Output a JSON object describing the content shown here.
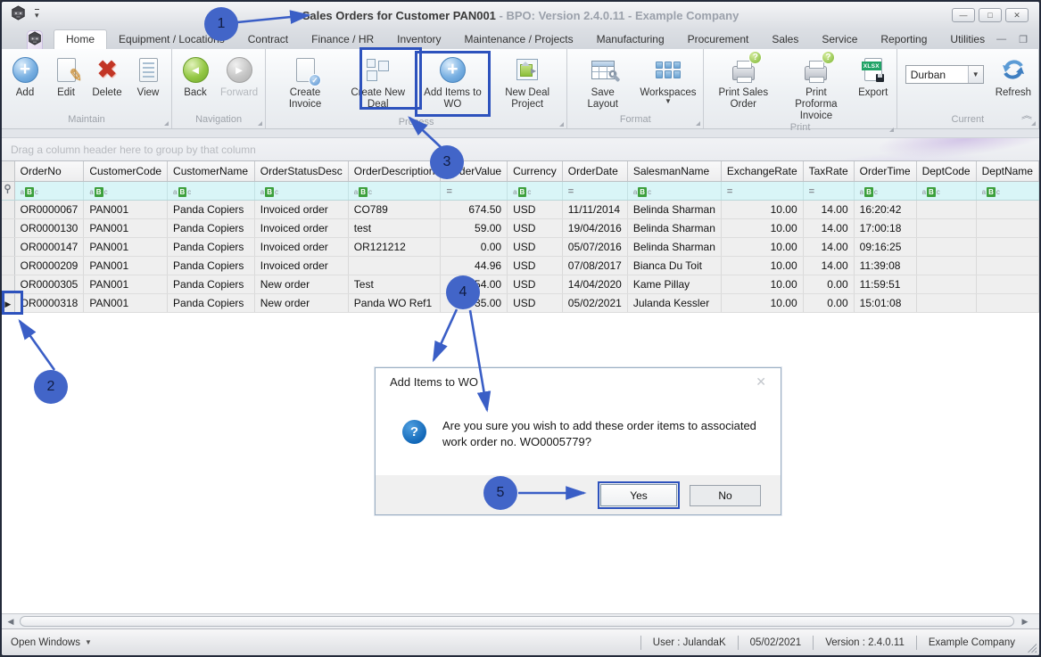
{
  "window": {
    "title_primary": "Sales Orders for Customer PAN001",
    "title_secondary": " - BPO: Version 2.4.0.11 - Example Company"
  },
  "tabs": [
    {
      "label": "Home",
      "active": true
    },
    {
      "label": "Equipment / Locations"
    },
    {
      "label": "Contract"
    },
    {
      "label": "Finance / HR"
    },
    {
      "label": "Inventory"
    },
    {
      "label": "Maintenance / Projects"
    },
    {
      "label": "Manufacturing"
    },
    {
      "label": "Procurement"
    },
    {
      "label": "Sales"
    },
    {
      "label": "Service"
    },
    {
      "label": "Reporting"
    },
    {
      "label": "Utilities"
    }
  ],
  "ribbon": {
    "groups": [
      {
        "label": "Maintain",
        "buttons": [
          {
            "label": "Add",
            "icon": "add-circle"
          },
          {
            "label": "Edit",
            "icon": "edit-pencil"
          },
          {
            "label": "Delete",
            "icon": "delete-x"
          },
          {
            "label": "View",
            "icon": "view-doc"
          }
        ]
      },
      {
        "label": "Navigation",
        "buttons": [
          {
            "label": "Back",
            "icon": "back-circle"
          },
          {
            "label": "Forward",
            "icon": "forward-circle",
            "disabled": true
          }
        ]
      },
      {
        "label": "Process",
        "buttons": [
          {
            "label": "Create Invoice",
            "icon": "invoice-doc"
          },
          {
            "label": "Create New Deal",
            "icon": "new-deal-squares"
          },
          {
            "label": "Add Items to WO",
            "icon": "add-circle",
            "highlighted": true
          },
          {
            "label": "New Deal Project",
            "icon": "deal-project"
          }
        ]
      },
      {
        "label": "Format",
        "buttons": [
          {
            "label": "Save Layout",
            "icon": "save-layout"
          },
          {
            "label": "Workspaces",
            "icon": "workspaces-grid",
            "dropdown": true
          }
        ]
      },
      {
        "label": "Print",
        "buttons": [
          {
            "label": "Print Sales Order",
            "icon": "printer-question"
          },
          {
            "label": "Print Proforma Invoice",
            "icon": "printer-question"
          },
          {
            "label": "Export",
            "icon": "export-xlsx"
          }
        ]
      },
      {
        "label": "Current",
        "buttons": [
          {
            "type": "combo",
            "value": "Durban"
          },
          {
            "label": "Refresh",
            "icon": "refresh-arrows"
          }
        ]
      }
    ]
  },
  "grid": {
    "group_by_hint": "Drag a column header here to group by that column",
    "filter_glyphs": {
      "text_a": "a",
      "text_b": "B",
      "text_c": "c",
      "numeric": "="
    },
    "columns": [
      {
        "label": "OrderNo",
        "filter": "abc"
      },
      {
        "label": "CustomerCode",
        "filter": "abc"
      },
      {
        "label": "CustomerName",
        "filter": "abc"
      },
      {
        "label": "OrderStatusDesc",
        "filter": "abc"
      },
      {
        "label": "OrderDescription",
        "filter": "abc"
      },
      {
        "label": "OrderValue",
        "filter": "eq"
      },
      {
        "label": "Currency",
        "filter": "abc"
      },
      {
        "label": "OrderDate",
        "filter": "eq"
      },
      {
        "label": "SalesmanName",
        "filter": "abc"
      },
      {
        "label": "ExchangeRate",
        "filter": "eq"
      },
      {
        "label": "TaxRate",
        "filter": "eq"
      },
      {
        "label": "OrderTime",
        "filter": "abc"
      },
      {
        "label": "DeptCode",
        "filter": "abc"
      },
      {
        "label": "DeptName",
        "filter": "abc"
      }
    ],
    "rows": [
      [
        "OR0000067",
        "PAN001",
        "Panda Copiers",
        "Invoiced order",
        "CO789",
        "674.50",
        "USD",
        "11/11/2014",
        "Belinda Sharman",
        "10.00",
        "14.00",
        "16:20:42",
        "",
        ""
      ],
      [
        "OR0000130",
        "PAN001",
        "Panda Copiers",
        "Invoiced order",
        "test",
        "59.00",
        "USD",
        "19/04/2016",
        "Belinda Sharman",
        "10.00",
        "14.00",
        "17:00:18",
        "",
        ""
      ],
      [
        "OR0000147",
        "PAN001",
        "Panda Copiers",
        "Invoiced order",
        "OR121212",
        "0.00",
        "USD",
        "05/07/2016",
        "Belinda Sharman",
        "10.00",
        "14.00",
        "09:16:25",
        "",
        ""
      ],
      [
        "OR0000209",
        "PAN001",
        "Panda Copiers",
        "Invoiced order",
        "",
        "44.96",
        "USD",
        "07/08/2017",
        "Bianca Du Toit",
        "10.00",
        "14.00",
        "11:39:08",
        "",
        ""
      ],
      [
        "OR0000305",
        "PAN001",
        "Panda Copiers",
        "New order",
        "Test",
        "854.00",
        "USD",
        "14/04/2020",
        "Kame Pillay",
        "10.00",
        "0.00",
        "11:59:51",
        "",
        ""
      ],
      [
        "OR0000318",
        "PAN001",
        "Panda Copiers",
        "New order",
        "Panda WO Ref1",
        "35.00",
        "USD",
        "05/02/2021",
        "Julanda Kessler",
        "10.00",
        "0.00",
        "15:01:08",
        "",
        ""
      ]
    ],
    "focused_row_index": 5
  },
  "dialog": {
    "title": "Add Items to WO",
    "message": "Are you sure you wish to add these order items to associated work order no. WO0005779?",
    "yes_label": "Yes",
    "no_label": "No"
  },
  "status_bar": {
    "open_windows": "Open Windows",
    "segments": [
      "User : JulandaK",
      "05/02/2021",
      "Version : 2.4.0.11",
      "Example Company"
    ]
  },
  "annotations": {
    "callouts": [
      "1",
      "2",
      "3",
      "4",
      "5"
    ]
  },
  "colors": {
    "annotation_blue": "#3a5ec6",
    "highlight_border": "#2d52bd",
    "callout_fill": "#4265c8",
    "filter_row_bg": "#d9f5f7",
    "filter_abc_green": "#3da03d"
  }
}
